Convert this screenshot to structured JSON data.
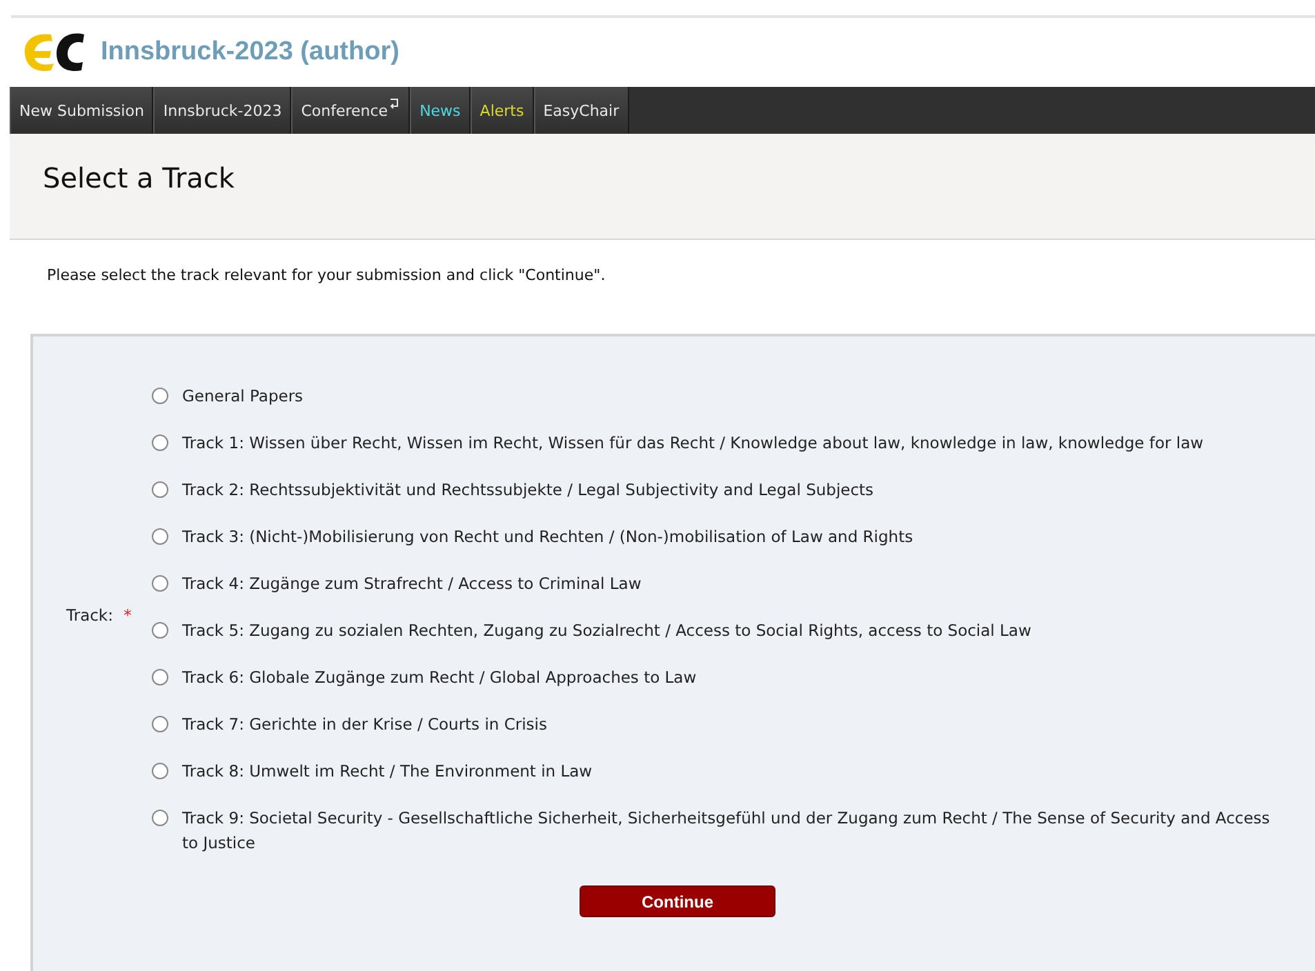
{
  "header": {
    "title": "Innsbruck-2023 (author)"
  },
  "menu": [
    {
      "label": "New Submission",
      "kind": "plain",
      "icon": false
    },
    {
      "label": "Innsbruck-2023",
      "kind": "plain",
      "icon": false
    },
    {
      "label": "Conference",
      "kind": "plain",
      "icon": true
    },
    {
      "label": "News",
      "kind": "news",
      "icon": false
    },
    {
      "label": "Alerts",
      "kind": "alerts",
      "icon": false
    },
    {
      "label": "EasyChair",
      "kind": "plain",
      "icon": false
    }
  ],
  "page_title": "Select a Track",
  "instructions": "Please select the track relevant for your submission and click \"Continue\".",
  "form": {
    "label": "Track:",
    "required_mark": "*",
    "options": [
      {
        "label": "General Papers",
        "selected": false
      },
      {
        "label": "Track 1: Wissen über Recht, Wissen im Recht, Wissen für das Recht / Knowledge about law, knowledge in law, knowledge for law",
        "selected": false
      },
      {
        "label": "Track 2: Rechtssubjektivität und Rechtssubjekte / Legal Subjectivity and Legal Subjects",
        "selected": false
      },
      {
        "label": "Track 3: (Nicht-)Mobilisierung von Recht und Rechten / (Non-)mobilisation of Law and Rights",
        "selected": false
      },
      {
        "label": "Track 4: Zugänge zum Strafrecht / Access to Criminal Law",
        "selected": false
      },
      {
        "label": "Track 5: Zugang zu sozialen Rechten, Zugang zu Sozialrecht / Access to Social Rights, access to Social Law",
        "selected": false
      },
      {
        "label": "Track 6: Globale Zugänge zum Recht / Global Approaches to Law",
        "selected": false
      },
      {
        "label": "Track 7: Gerichte in der Krise / Courts in Crisis",
        "selected": false
      },
      {
        "label": "Track 8: Umwelt im Recht / The Environment in Law",
        "selected": false
      },
      {
        "label": "Track 9: Societal Security - Gesellschaftliche Sicherheit, Sicherheitsgefühl und der Zugang zum Recht / The Sense of Security and Access to Justice",
        "selected": false
      }
    ],
    "button": "Continue"
  }
}
